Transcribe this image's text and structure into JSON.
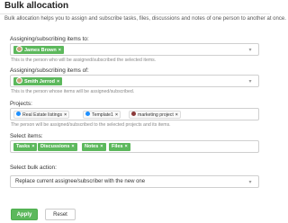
{
  "header": {
    "title": "Bulk allocation"
  },
  "intro_text": "Bulk allocation helps you to assign and subscribe tasks, files, discussions and notes of one person to another at once.",
  "assign_to": {
    "label": "Assigning/subscribing items to:",
    "chip": "James Brown",
    "helper": "This is the person who will be assigned/subscribed the selected items."
  },
  "assign_of": {
    "label": "Assigning/subscribing items of:",
    "chip": "Smith Jerrod",
    "helper": "This is the person whose items will be assigned/subscribed."
  },
  "projects": {
    "label": "Projects:",
    "items": [
      {
        "name": "Real Estate listings",
        "color": "#1e90ff"
      },
      {
        "name": "Template1",
        "color": "#1e90ff"
      },
      {
        "name": "marketing project",
        "color": "#8b3a3a"
      }
    ],
    "helper": "The person will be assigned/subscribed to the selected projects and its items."
  },
  "select_items": {
    "label": "Select items:",
    "chips": [
      "Tasks",
      "Discussions",
      "Notes",
      "Files"
    ]
  },
  "bulk_action": {
    "label": "Select bulk action:",
    "selected": "Replace current assignee/subscriber with the new one"
  },
  "buttons": {
    "apply": "Apply",
    "reset": "Reset"
  },
  "icons": {
    "remove": "close-icon",
    "dropdown": "chevron-down-icon"
  },
  "colors": {
    "accent_green": "#5cb85c"
  }
}
